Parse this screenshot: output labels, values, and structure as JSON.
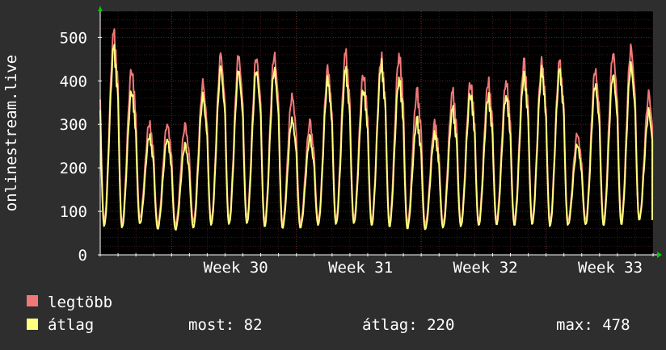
{
  "chart_data": {
    "type": "line",
    "ylabel": "onlinestream.live",
    "ylim": [
      0,
      560
    ],
    "yticks": [
      0,
      100,
      200,
      300,
      400,
      500
    ],
    "xtick_labels": [
      "Week 30",
      "Week 31",
      "Week 32",
      "Week 33"
    ],
    "days": 31,
    "series": [
      {
        "name": "legtöbb",
        "color": "#f07878",
        "daily_peaks": [
          510,
          430,
          305,
          305,
          300,
          395,
          460,
          460,
          460,
          465,
          370,
          305,
          430,
          465,
          420,
          455,
          465,
          375,
          305,
          375,
          400,
          400,
          405,
          445,
          445,
          445,
          280,
          430,
          470,
          480,
          370
        ],
        "daily_lows": [
          75,
          72,
          85,
          70,
          68,
          75,
          78,
          80,
          85,
          75,
          70,
          72,
          78,
          80,
          82,
          78,
          75,
          70,
          68,
          72,
          75,
          78,
          80,
          78,
          80,
          75,
          78,
          80,
          78,
          80,
          82
        ]
      },
      {
        "name": "átlag",
        "color": "#ffff80",
        "daily_peaks": [
          475,
          380,
          275,
          270,
          255,
          365,
          430,
          425,
          430,
          430,
          315,
          270,
          405,
          425,
          385,
          440,
          410,
          310,
          280,
          335,
          375,
          365,
          370,
          415,
          425,
          425,
          255,
          395,
          420,
          440,
          330
        ],
        "daily_lows": [
          65,
          62,
          72,
          60,
          58,
          62,
          68,
          70,
          72,
          65,
          62,
          62,
          68,
          70,
          72,
          68,
          65,
          60,
          58,
          62,
          65,
          68,
          70,
          68,
          70,
          65,
          68,
          70,
          68,
          70,
          80
        ]
      }
    ]
  },
  "legend": {
    "items": [
      {
        "label": "legtöbb",
        "color": "#f07878"
      },
      {
        "label": "átlag",
        "color": "#ffff80"
      }
    ],
    "stats": {
      "most": "most: 82",
      "atlag": "átlag: 220",
      "max": "max: 478"
    }
  },
  "colors": {
    "background": "#2e2e2e",
    "plot_background": "#000000",
    "grid": "#5a2a2a",
    "axis": "#ffffff",
    "arrow": "#00cc00"
  }
}
